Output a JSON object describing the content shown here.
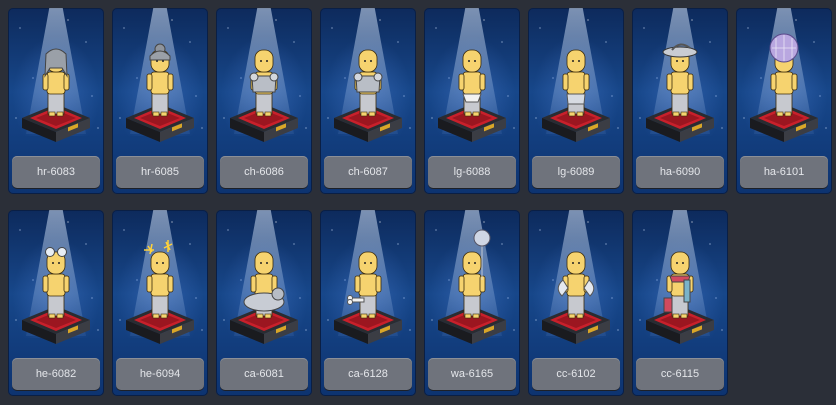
{
  "items": [
    {
      "code": "hr-6083",
      "icon": "gray-hair-icon"
    },
    {
      "code": "hr-6085",
      "icon": "hair-bun-icon"
    },
    {
      "code": "ch-6086",
      "icon": "armor-top-icon"
    },
    {
      "code": "ch-6087",
      "icon": "armor-top-icon"
    },
    {
      "code": "lg-6088",
      "icon": "diaper-icon"
    },
    {
      "code": "lg-6089",
      "icon": "shorts-icon"
    },
    {
      "code": "ha-6090",
      "icon": "feather-hat-icon"
    },
    {
      "code": "ha-6101",
      "icon": "disco-ball-hat-icon"
    },
    {
      "code": "he-6082",
      "icon": "goggles-icon"
    },
    {
      "code": "he-6094",
      "icon": "sparkler-icon"
    },
    {
      "code": "ca-6081",
      "icon": "cat-float-icon"
    },
    {
      "code": "ca-6128",
      "icon": "bone-icon"
    },
    {
      "code": "wa-6165",
      "icon": "disco-ball-balloon-icon"
    },
    {
      "code": "cc-6102",
      "icon": "wings-icon"
    },
    {
      "code": "cc-6115",
      "icon": "striped-scarf-icon"
    }
  ],
  "colors": {
    "page_bg": "#2b2f38",
    "card_bg": "#17478a",
    "label_bg": "#6f737c",
    "pedestal_red": "#c8202b",
    "skin": "#f6d36f"
  }
}
